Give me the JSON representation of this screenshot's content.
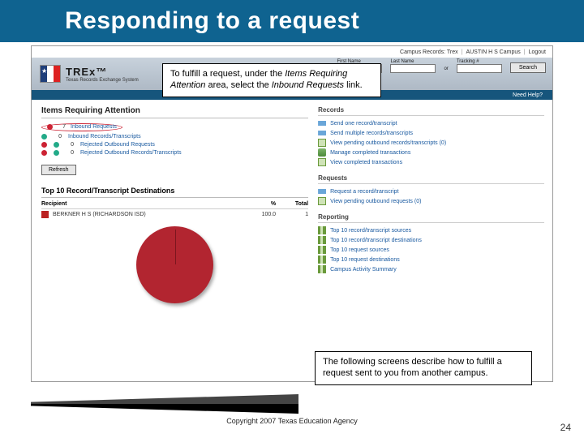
{
  "slide": {
    "title": "Responding to a request",
    "copyright": "Copyright 2007 Texas Education Agency",
    "page_number": "24"
  },
  "callouts": {
    "top_pre": "To fulfill a request, under the ",
    "top_em1": "Items Requiring Attention",
    "top_mid": " area, select the ",
    "top_em2": "Inbound Requests",
    "top_post": " link.",
    "bottom": "The following screens describe how to fulfill a request sent to you from another campus."
  },
  "context": {
    "label": "Campus Records: Trex",
    "campus": "AUSTIN H S Campus",
    "logout": "Logout"
  },
  "brand": {
    "name": "TREx™",
    "sub": "Texas Records Exchange System"
  },
  "search": {
    "first": "First Name",
    "last": "Last Name",
    "track": "Tracking #",
    "or": "or",
    "btn": "Search"
  },
  "subbar": {
    "help": "Need Help?"
  },
  "attention": {
    "title": "Items Requiring Attention",
    "rows": [
      {
        "count": "7",
        "label": "Inbound Requests"
      },
      {
        "count": "0",
        "label": "Inbound Records/Transcripts"
      },
      {
        "count": "0",
        "label": "Rejected Outbound Requests"
      },
      {
        "count": "0",
        "label": "Rejected Outbound Records/Transcripts"
      }
    ],
    "refresh": "Refresh"
  },
  "top10": {
    "title": "Top 10 Record/Transcript Destinations",
    "h_recipient": "Recipient",
    "h_pct": "%",
    "h_total": "Total",
    "row_label": "BERKNER H S (RICHARDSON ISD)",
    "row_pct": "100.0",
    "row_total": "1"
  },
  "right": {
    "records_title": "Records",
    "records": [
      "Send one record/transcript",
      "Send multiple records/transcripts",
      "View pending outbound records/transcripts (0)",
      "Manage completed transactions",
      "View completed transactions"
    ],
    "requests_title": "Requests",
    "requests": [
      "Request a record/transcript",
      "View pending outbound requests (0)"
    ],
    "reporting_title": "Reporting",
    "reporting": [
      "Top 10 record/transcript sources",
      "Top 10 record/transcript destinations",
      "Top 10 request sources",
      "Top 10 request destinations",
      "Campus Activity Summary"
    ]
  },
  "chart_data": {
    "type": "pie",
    "title": "Top 10 Record/Transcript Destinations",
    "categories": [
      "BERKNER H S (RICHARDSON ISD)"
    ],
    "values": [
      100.0
    ]
  }
}
